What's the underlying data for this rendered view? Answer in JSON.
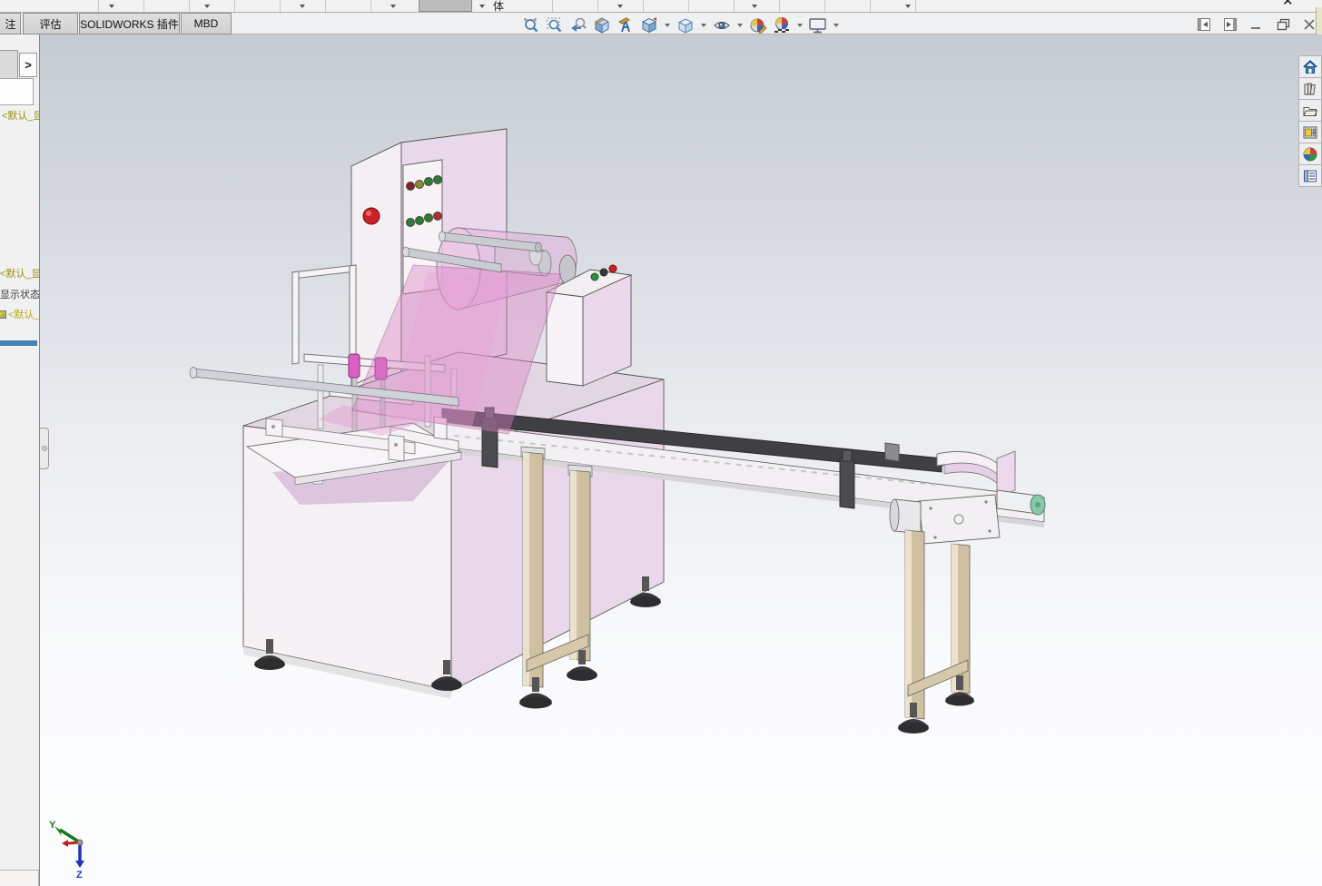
{
  "app": {
    "partial_toolbar_label": "体",
    "close_glyph": "✕"
  },
  "command_manager": {
    "tabs": [
      {
        "id": "annotation",
        "label": "注"
      },
      {
        "id": "evaluate",
        "label": "评估"
      },
      {
        "id": "solidworks_addins",
        "label": "SOLIDWORKS 插件"
      },
      {
        "id": "mbd",
        "label": "MBD"
      }
    ]
  },
  "headsup_toolbar": {
    "icons": [
      {
        "name": "zoom-to-fit",
        "dropdown": false
      },
      {
        "name": "zoom-to-area",
        "dropdown": false
      },
      {
        "name": "previous-view",
        "dropdown": false
      },
      {
        "name": "section-view",
        "dropdown": false
      },
      {
        "name": "dynamic-annotation-views",
        "dropdown": false
      },
      {
        "name": "view-orientation",
        "dropdown": true
      },
      {
        "name": "display-style",
        "dropdown": true
      },
      {
        "name": "hide-show-items",
        "dropdown": true
      },
      {
        "name": "edit-appearance",
        "dropdown": false
      },
      {
        "name": "apply-scene",
        "dropdown": true
      },
      {
        "name": "view-settings",
        "dropdown": true
      }
    ]
  },
  "window_controls": [
    "dock-pane-left",
    "dock-pane-right",
    "minimize",
    "restore",
    "close"
  ],
  "feature_panel": {
    "expand_arrow": ">",
    "config_caption": "<默认_显",
    "tree": [
      {
        "label": "<默认_显"
      },
      {
        "label": "显示状态-"
      },
      {
        "label": "<默认_"
      }
    ],
    "accent_color": "#4584b4"
  },
  "task_pane": {
    "icons": [
      "home",
      "design-library",
      "file-explorer",
      "view-palette",
      "appearances-scenes",
      "custom-properties"
    ]
  },
  "viewport": {
    "background_top": "#c6cbd3",
    "background_bottom": "#fbfcfd",
    "triad": {
      "y_label": "Y",
      "z_label": "Z",
      "x_color": "#b92222",
      "y_color": "#1a7a1a",
      "z_color": "#2233bb"
    }
  },
  "model": {
    "name": "pillow-packaging-machine-with-conveyor",
    "colors": {
      "body_white": "#f6f1f5",
      "body_pink": "#e9d8ea",
      "film_pink": "rgba(219,132,196,0.42)",
      "drum_pink": "#d9b8d9",
      "leg_tan": "#cfc0a2",
      "foot_dark": "#38383a",
      "estop_red": "#cc2127",
      "end_cap_green": "#8cc8a8",
      "steel": "#c9ccd2",
      "track_dark": "#3f3f44"
    }
  }
}
